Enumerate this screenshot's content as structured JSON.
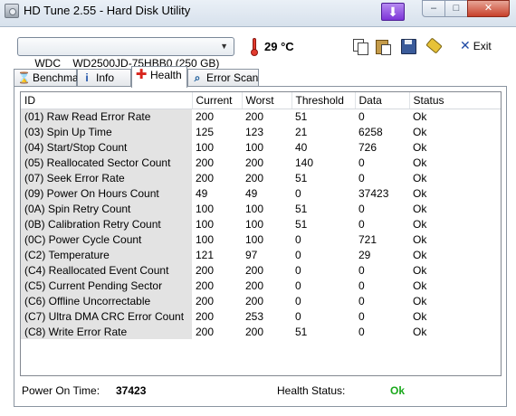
{
  "window": {
    "title": "HD Tune 2.55 - Hard Disk Utility",
    "down_glyph": "⬇",
    "minimize_glyph": "–",
    "maximize_glyph": "□",
    "close_glyph": "✕"
  },
  "toolbar": {
    "drive": "WDC    WD2500JD-75HBB0 (250 GB)",
    "drive_arrow": "▼",
    "temperature": "29 °C",
    "exit_glyph": "✕",
    "exit_label": "Exit"
  },
  "tabs": [
    {
      "label": "Benchmark",
      "icon": "⌛"
    },
    {
      "label": "Info",
      "icon": "i"
    },
    {
      "label": "Health",
      "icon": "✚"
    },
    {
      "label": "Error Scan",
      "icon": "⌕"
    }
  ],
  "health": {
    "columns": [
      "ID",
      "Current",
      "Worst",
      "Threshold",
      "Data",
      "Status"
    ],
    "rows": [
      [
        "(01) Raw Read Error Rate",
        "200",
        "200",
        "51",
        "0",
        "Ok"
      ],
      [
        "(03) Spin Up Time",
        "125",
        "123",
        "21",
        "6258",
        "Ok"
      ],
      [
        "(04) Start/Stop Count",
        "100",
        "100",
        "40",
        "726",
        "Ok"
      ],
      [
        "(05) Reallocated Sector Count",
        "200",
        "200",
        "140",
        "0",
        "Ok"
      ],
      [
        "(07) Seek Error Rate",
        "200",
        "200",
        "51",
        "0",
        "Ok"
      ],
      [
        "(09) Power On Hours Count",
        "49",
        "49",
        "0",
        "37423",
        "Ok"
      ],
      [
        "(0A) Spin Retry Count",
        "100",
        "100",
        "51",
        "0",
        "Ok"
      ],
      [
        "(0B) Calibration Retry Count",
        "100",
        "100",
        "51",
        "0",
        "Ok"
      ],
      [
        "(0C) Power Cycle Count",
        "100",
        "100",
        "0",
        "721",
        "Ok"
      ],
      [
        "(C2) Temperature",
        "121",
        "97",
        "0",
        "29",
        "Ok"
      ],
      [
        "(C4) Reallocated Event Count",
        "200",
        "200",
        "0",
        "0",
        "Ok"
      ],
      [
        "(C5) Current Pending Sector",
        "200",
        "200",
        "0",
        "0",
        "Ok"
      ],
      [
        "(C6) Offline Uncorrectable",
        "200",
        "200",
        "0",
        "0",
        "Ok"
      ],
      [
        "(C7) Ultra DMA CRC Error Count",
        "200",
        "253",
        "0",
        "0",
        "Ok"
      ],
      [
        "(C8) Write Error Rate",
        "200",
        "200",
        "51",
        "0",
        "Ok"
      ]
    ],
    "power_on_time_label": "Power On Time:",
    "power_on_time_value": "37423",
    "health_status_label": "Health Status:",
    "health_status_value": "Ok"
  }
}
